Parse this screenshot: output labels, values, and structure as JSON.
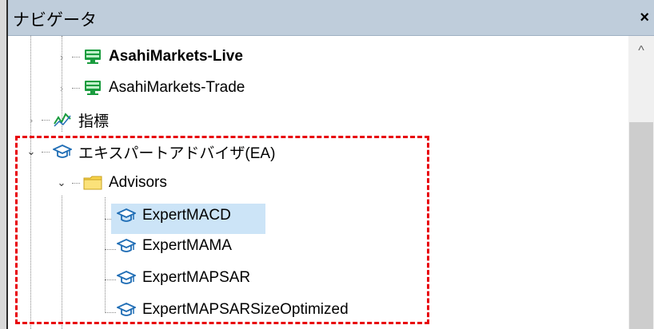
{
  "window": {
    "title": "ナビゲータ",
    "close_glyph": "×"
  },
  "scrollbar": {
    "up_arrow": "^"
  },
  "tree": {
    "accounts": [
      {
        "label": "AsahiMarkets-Live",
        "bold": true,
        "icon": "server-icon"
      },
      {
        "label": "AsahiMarkets-Trade",
        "bold": false,
        "icon": "server-icon"
      }
    ],
    "indicators": {
      "label": "指標",
      "icon": "indicator-icon"
    },
    "expert_advisors": {
      "label": "エキスパートアドバイザ(EA)",
      "icon": "graduation-cap-icon",
      "folder": {
        "label": "Advisors",
        "icon": "folder-icon",
        "items": [
          {
            "label": "ExpertMACD",
            "selected": true
          },
          {
            "label": "ExpertMAMA",
            "selected": false
          },
          {
            "label": "ExpertMAPSAR",
            "selected": false
          },
          {
            "label": "ExpertMAPSARSizeOptimized",
            "selected": false
          }
        ]
      }
    }
  },
  "colors": {
    "titlebar": "#bfcddb",
    "selection": "#cce4f7",
    "highlight_box": "#e8000b",
    "folder": "#f8d34a",
    "server": "#1a9c3e",
    "cap": "#1f6db5"
  },
  "icons": {
    "collapsed_twisty": "›",
    "expanded_twisty": "⌄"
  }
}
